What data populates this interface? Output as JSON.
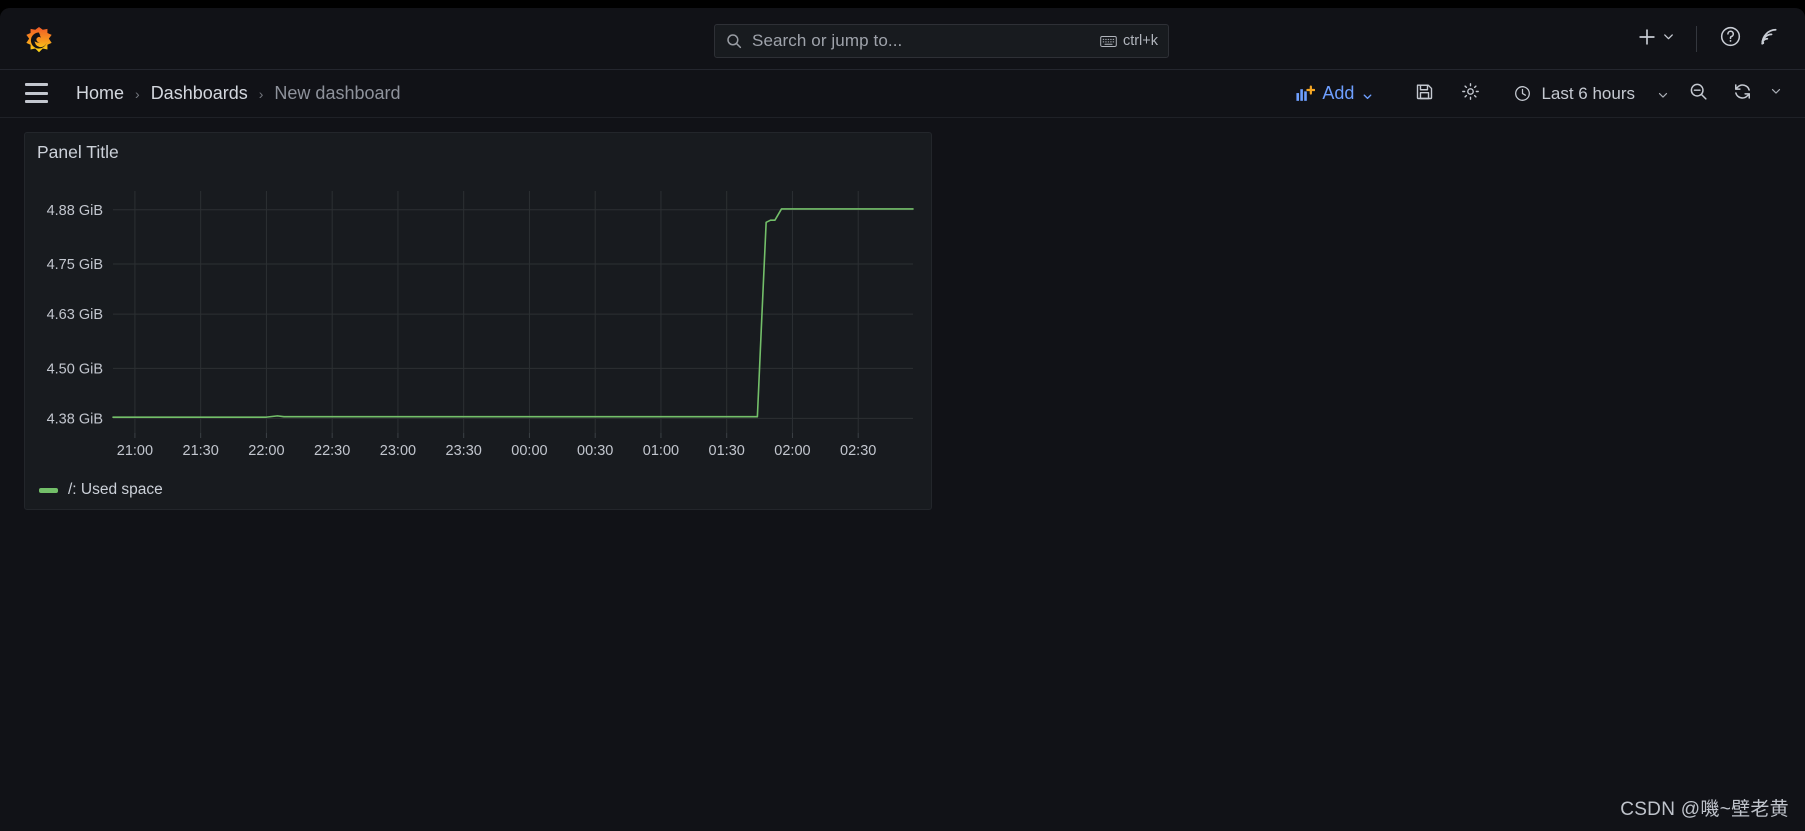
{
  "app": {
    "logo_icon": "grafana-logo-icon",
    "background": "#111217",
    "panel_bg": "#181b1f"
  },
  "topnav": {
    "search": {
      "placeholder": "Search or jump to...",
      "icon": "search-icon",
      "shortcut_label": "ctrl+k",
      "shortcut_icon": "keyboard-icon"
    },
    "actions": [
      {
        "name": "new-button",
        "icon": "plus-icon",
        "label": ""
      },
      {
        "name": "new-dropdown",
        "icon": "chevron-down-icon",
        "label": ""
      },
      {
        "name": "help-button",
        "icon": "help-circle-icon",
        "label": ""
      },
      {
        "name": "news-button",
        "icon": "rss-feed-icon",
        "label": ""
      }
    ]
  },
  "subnav": {
    "menu_icon": "hamburger-menu-icon",
    "breadcrumb": [
      {
        "label": "Home",
        "current": false
      },
      {
        "label": "Dashboards",
        "current": false
      },
      {
        "label": "New dashboard",
        "current": true
      }
    ],
    "separator": "›"
  },
  "toolbar": {
    "add_label": "Add",
    "add_icon": "add-panel-icon",
    "add_chevron": "chevron-down-icon",
    "add_color": "#6e9fff",
    "save_icon": "save-disk-icon",
    "settings_icon": "gear-icon",
    "time_range": {
      "label": "Last 6 hours",
      "icon": "clock-icon",
      "chevron": "chevron-down-icon"
    },
    "zoom_out_icon": "zoom-out-icon",
    "refresh_icon": "refresh-icon",
    "refresh_chevron": "chevron-down-icon"
  },
  "panel": {
    "title": "Panel Title",
    "legend": [
      {
        "label": "/: Used space",
        "color": "#73bf69"
      }
    ]
  },
  "watermark": {
    "text": "CSDN @嘰~壁老黄"
  },
  "chart_data": {
    "type": "line",
    "title": "Panel Title",
    "xlabel": "",
    "ylabel": "",
    "grid": true,
    "legend_position": "bottom-left",
    "series": [
      {
        "name": "/: Used space",
        "color": "#73bf69",
        "unit": "GiB",
        "x": [
          "20:50",
          "21:00",
          "21:30",
          "22:00",
          "22:05",
          "22:08",
          "22:30",
          "23:00",
          "23:30",
          "00:00",
          "00:30",
          "01:00",
          "01:30",
          "01:44",
          "01:46",
          "01:48",
          "01:50",
          "01:52",
          "01:55",
          "02:00",
          "02:30",
          "02:55"
        ],
        "values": [
          4.383,
          4.383,
          4.383,
          4.383,
          4.386,
          4.384,
          4.384,
          4.384,
          4.384,
          4.384,
          4.384,
          4.384,
          4.384,
          4.384,
          4.62,
          4.85,
          4.855,
          4.855,
          4.882,
          4.882,
          4.882,
          4.882
        ]
      }
    ],
    "x_ticks": [
      "21:00",
      "21:30",
      "22:00",
      "22:30",
      "23:00",
      "23:30",
      "00:00",
      "00:30",
      "01:00",
      "01:30",
      "02:00",
      "02:30"
    ],
    "y_ticks": [
      "4.38 GiB",
      "4.50 GiB",
      "4.63 GiB",
      "4.75 GiB",
      "4.88 GiB"
    ],
    "y_tick_values": [
      4.38,
      4.5,
      4.63,
      4.75,
      4.88
    ],
    "ylim": [
      4.345,
      4.925
    ],
    "xlim": [
      "20:50",
      "02:55"
    ]
  }
}
